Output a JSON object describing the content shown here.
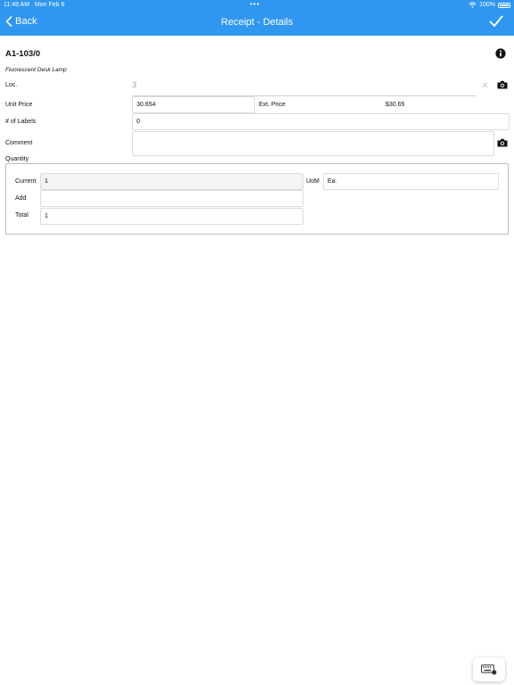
{
  "status_bar": {
    "time": "11:48 AM",
    "date": "Mon Feb 6",
    "dots": "•••",
    "battery": "100%"
  },
  "nav": {
    "back_label": "Back",
    "title": "Receipt - Details"
  },
  "item": {
    "code": "A1-103/0",
    "description": "Fluorescent Desk Lamp"
  },
  "form": {
    "loc_label": "Loc.",
    "loc_value": "3",
    "unit_price_label": "Unit Price",
    "unit_price_value": "30.654",
    "ext_price_label": "Ext. Price",
    "ext_price_value": "$30.65",
    "labels_label": "# of Labels",
    "labels_value": "0",
    "comment_label": "Comment",
    "comment_value": ""
  },
  "quantity": {
    "section_label": "Quantity",
    "current_label": "Current",
    "current_value": "1",
    "uom_label": "UoM",
    "uom_value": "Ea.",
    "add_label": "Add",
    "add_value": "",
    "total_label": "Total",
    "total_value": "1"
  },
  "icons": {
    "info": "info-icon",
    "camera": "camera-icon",
    "clear": "clear-icon",
    "keyboard": "keyboard-icon",
    "check": "checkmark-icon",
    "back": "chevron-left-icon"
  },
  "colors": {
    "header": "#2f97ef",
    "text": "#111111",
    "border": "#dcdcdc"
  }
}
